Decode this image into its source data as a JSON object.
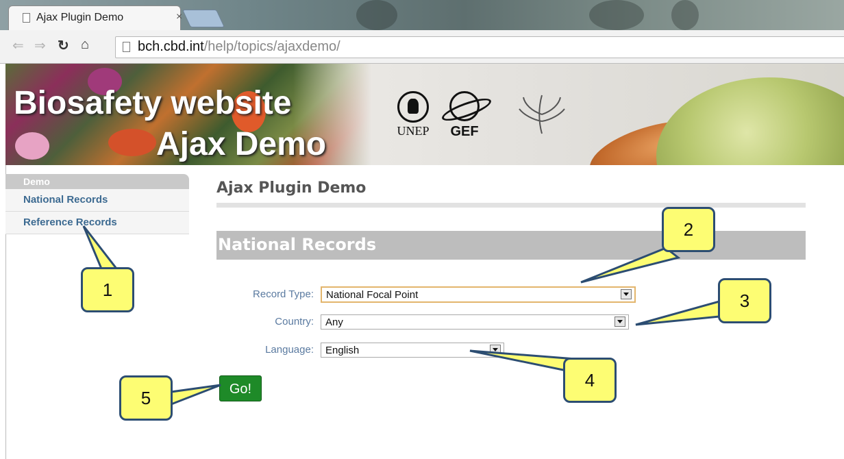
{
  "browser": {
    "tab_title": "Ajax Plugin Demo",
    "tab_close": "×",
    "url_host": "bch.cbd.int",
    "url_path": "/help/topics/ajaxdemo/"
  },
  "banner": {
    "title_line1": "Biosafety website",
    "title_line2": "Ajax Demo",
    "logo_unep_label": "UNEP",
    "logo_gef_label": "GEF"
  },
  "sidebar": {
    "header": "Demo",
    "items": [
      {
        "label": "National Records"
      },
      {
        "label": "Reference Records"
      }
    ]
  },
  "main": {
    "page_title": "Ajax Plugin Demo",
    "section_title": "National Records",
    "form": {
      "record_type_label": "Record Type:",
      "record_type_value": "National Focal Point",
      "country_label": "Country:",
      "country_value": "Any",
      "language_label": "Language:",
      "language_value": "English",
      "go_label": "Go!"
    }
  },
  "callouts": [
    "1",
    "2",
    "3",
    "4",
    "5"
  ],
  "colors": {
    "link_blue": "#3c6a91",
    "go_green": "#1e8a28",
    "callout_yellow": "#fdfd73",
    "callout_border": "#2c4d72"
  }
}
